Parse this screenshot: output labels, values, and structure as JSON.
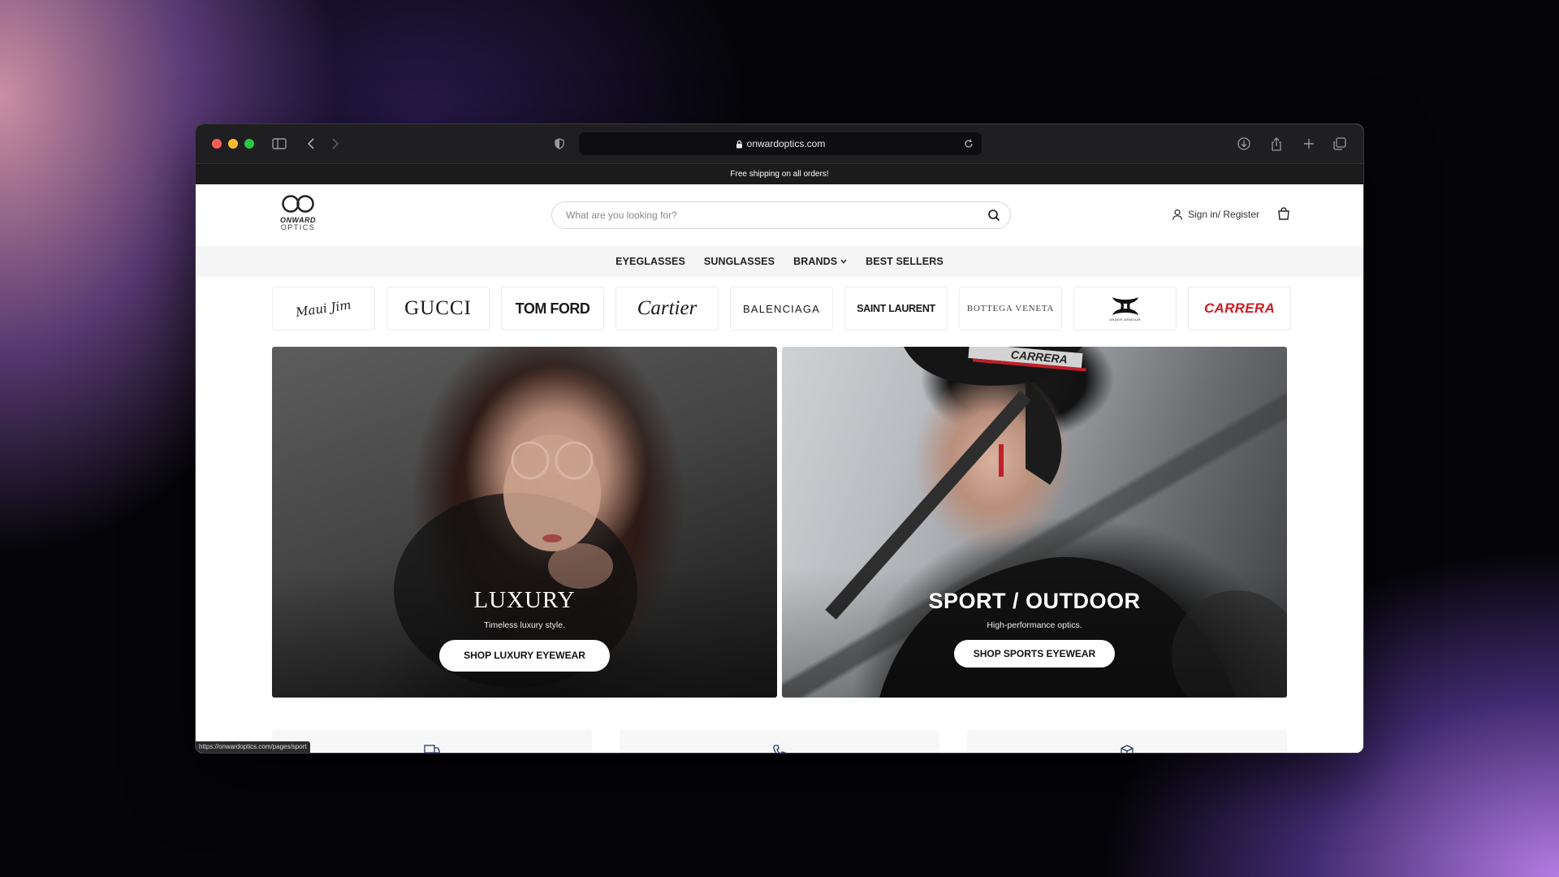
{
  "browser": {
    "url": "onwardoptics.com",
    "status_url": "https://onwardoptics.com/pages/sport",
    "traffic_colors": [
      "#fe5f57",
      "#febc2e",
      "#28c840"
    ]
  },
  "announcement": "Free shipping on all orders!",
  "logo": {
    "line1": "ONWARD",
    "line2": "OPTICS"
  },
  "search": {
    "placeholder": "What are you looking for?"
  },
  "account": {
    "label": "Sign in/ Register"
  },
  "nav": {
    "eyeglasses": "EYEGLASSES",
    "sunglasses": "SUNGLASSES",
    "brands": "BRANDS",
    "best_sellers": "BEST SELLERS"
  },
  "brands": {
    "maui_jim": "Maui Jim",
    "gucci": "GUCCI",
    "tom_ford": "TOM FORD",
    "cartier": "Cartier",
    "balenciaga": "BALENCIAGA",
    "saint_laurent": "SAINT LAURENT",
    "bottega_veneta": "BOTTEGA VENETA",
    "under_armour": "UNDER ARMOUR",
    "carrera": "CARRERA"
  },
  "hero": {
    "luxury": {
      "title": "LUXURY",
      "subtitle": "Timeless luxury style.",
      "button": "SHOP LUXURY EYEWEAR"
    },
    "sport": {
      "title": "SPORT / OUTDOOR",
      "subtitle": "High-performance optics.",
      "button": "SHOP SPORTS EYEWEAR",
      "helmet_text": "CARRERA"
    }
  },
  "feature_icons": [
    "truck-icon",
    "phone-icon",
    "box-icon"
  ]
}
